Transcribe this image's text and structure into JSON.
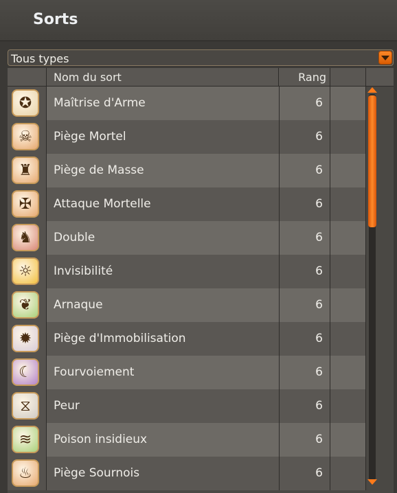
{
  "window": {
    "title": "Sorts"
  },
  "filter": {
    "selected": "Tous types"
  },
  "table": {
    "headers": {
      "name": "Nom du sort",
      "rank": "Rang"
    },
    "rows": [
      {
        "name": "Maîtrise d'Arme",
        "rank": "6",
        "icon": "star-emblem-icon",
        "color": "#e8d2a8"
      },
      {
        "name": "Piège Mortel",
        "rank": "6",
        "icon": "skull-trap-icon",
        "color": "#e6a870"
      },
      {
        "name": "Piège de Masse",
        "rank": "6",
        "icon": "group-trap-icon",
        "color": "#e6a870"
      },
      {
        "name": "Attaque Mortelle",
        "rank": "6",
        "icon": "deadly-strike-icon",
        "color": "#e6a870"
      },
      {
        "name": "Double",
        "rank": "6",
        "icon": "double-figure-icon",
        "color": "#d88878"
      },
      {
        "name": "Invisibilité",
        "rank": "6",
        "icon": "invisibility-icon",
        "color": "#f2c040"
      },
      {
        "name": "Arnaque",
        "rank": "6",
        "icon": "leaf-icon",
        "color": "#a8d07a"
      },
      {
        "name": "Piège d'Immobilisation",
        "rank": "6",
        "icon": "immobilize-trap-icon",
        "color": "#d8ccd8"
      },
      {
        "name": "Fourvoiement",
        "rank": "6",
        "icon": "mask-icon",
        "color": "#b282c8"
      },
      {
        "name": "Peur",
        "rank": "6",
        "icon": "fear-icon",
        "color": "#cfcac4"
      },
      {
        "name": "Poison insidieux",
        "rank": "6",
        "icon": "poison-icon",
        "color": "#a8d07a"
      },
      {
        "name": "Piège Sournois",
        "rank": "6",
        "icon": "sneaky-trap-icon",
        "color": "#e6a870"
      }
    ]
  },
  "scrollbar": {
    "position": 0.0
  }
}
